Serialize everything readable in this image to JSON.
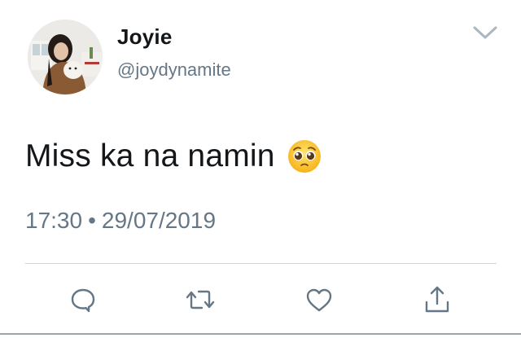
{
  "user": {
    "display_name": "Joyie",
    "handle": "@joydynamite"
  },
  "tweet": {
    "text": "Miss ka na namin",
    "emoji": "pleading-face-emoji",
    "time": "17:30",
    "separator": "•",
    "date": "29/07/2019"
  },
  "actions": {
    "reply_icon": "reply-icon",
    "retweet_icon": "retweet-icon",
    "like_icon": "heart-icon",
    "share_icon": "share-icon"
  },
  "colors": {
    "primary_text": "#14171a",
    "secondary_text": "#657786",
    "divider": "#ccd6dd",
    "icon": "#657786"
  }
}
